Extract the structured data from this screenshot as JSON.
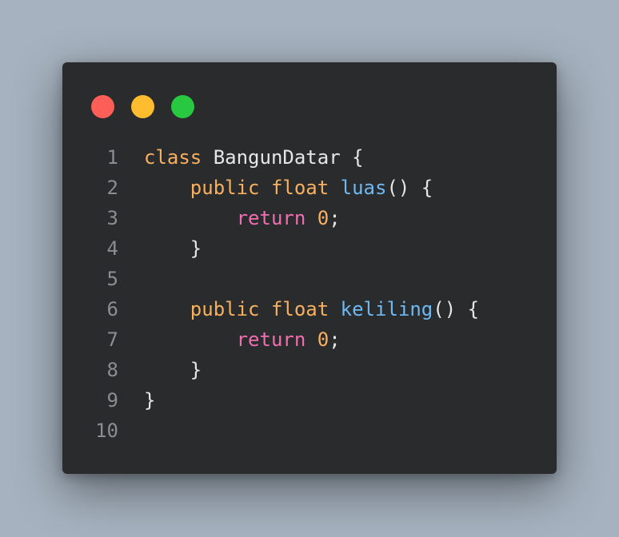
{
  "window": {
    "controls": [
      {
        "name": "close",
        "color": "#ff5f57"
      },
      {
        "name": "minimize",
        "color": "#febc2e"
      },
      {
        "name": "maximize",
        "color": "#28c840"
      }
    ]
  },
  "editor": {
    "lines": [
      {
        "number": "1",
        "tokens": [
          {
            "text": "class",
            "kind": "keyword"
          },
          {
            "text": " BangunDatar {",
            "kind": "plain"
          }
        ]
      },
      {
        "number": "2",
        "tokens": [
          {
            "text": "    ",
            "kind": "plain"
          },
          {
            "text": "public",
            "kind": "keyword"
          },
          {
            "text": " ",
            "kind": "plain"
          },
          {
            "text": "float",
            "kind": "keyword"
          },
          {
            "text": " ",
            "kind": "plain"
          },
          {
            "text": "luas",
            "kind": "fn"
          },
          {
            "text": "() {",
            "kind": "plain"
          }
        ]
      },
      {
        "number": "3",
        "tokens": [
          {
            "text": "        ",
            "kind": "plain"
          },
          {
            "text": "return",
            "kind": "return"
          },
          {
            "text": " ",
            "kind": "plain"
          },
          {
            "text": "0",
            "kind": "num"
          },
          {
            "text": ";",
            "kind": "plain"
          }
        ]
      },
      {
        "number": "4",
        "tokens": [
          {
            "text": "    }",
            "kind": "plain"
          }
        ]
      },
      {
        "number": "5",
        "tokens": []
      },
      {
        "number": "6",
        "tokens": [
          {
            "text": "    ",
            "kind": "plain"
          },
          {
            "text": "public",
            "kind": "keyword"
          },
          {
            "text": " ",
            "kind": "plain"
          },
          {
            "text": "float",
            "kind": "keyword"
          },
          {
            "text": " ",
            "kind": "plain"
          },
          {
            "text": "keliling",
            "kind": "fn"
          },
          {
            "text": "() {",
            "kind": "plain"
          }
        ]
      },
      {
        "number": "7",
        "tokens": [
          {
            "text": "        ",
            "kind": "plain"
          },
          {
            "text": "return",
            "kind": "return"
          },
          {
            "text": " ",
            "kind": "plain"
          },
          {
            "text": "0",
            "kind": "num"
          },
          {
            "text": ";",
            "kind": "plain"
          }
        ]
      },
      {
        "number": "8",
        "tokens": [
          {
            "text": "    }",
            "kind": "plain"
          }
        ]
      },
      {
        "number": "9",
        "tokens": [
          {
            "text": "}",
            "kind": "plain"
          }
        ]
      },
      {
        "number": "10",
        "tokens": []
      }
    ]
  }
}
